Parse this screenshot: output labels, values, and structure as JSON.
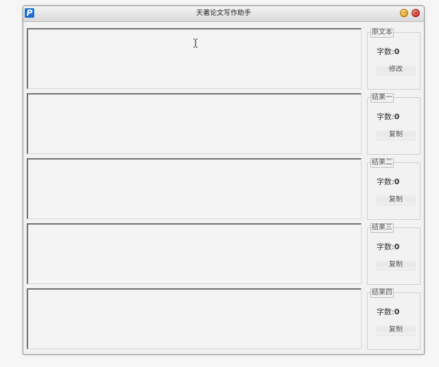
{
  "window": {
    "title": "天著论文写作助手",
    "app_icon_letter": "P",
    "minimize_icon": "minimize-icon",
    "close_icon": "close-icon"
  },
  "rows": [
    {
      "group_label": "原文本",
      "count_label": "字数:",
      "count_value": "0",
      "button_label": "修改",
      "text": ""
    },
    {
      "group_label": "结果一",
      "count_label": "字数:",
      "count_value": "0",
      "button_label": "复制",
      "text": ""
    },
    {
      "group_label": "结果二",
      "count_label": "字数:",
      "count_value": "0",
      "button_label": "复制",
      "text": ""
    },
    {
      "group_label": "结果三",
      "count_label": "字数:",
      "count_value": "0",
      "button_label": "复制",
      "text": ""
    },
    {
      "group_label": "结果四",
      "count_label": "字数:",
      "count_value": "0",
      "button_label": "复制",
      "text": ""
    }
  ],
  "colors": {
    "app_icon": "#1f6fd0",
    "minimize": "#e4a014",
    "close": "#d6302a"
  }
}
